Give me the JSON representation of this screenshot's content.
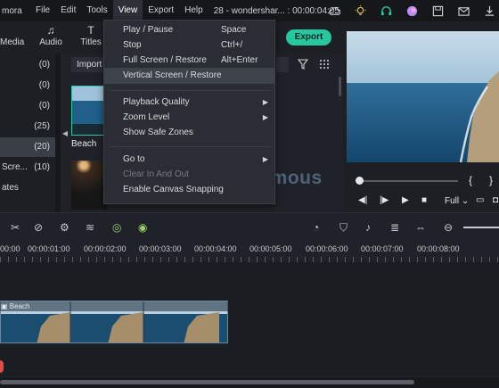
{
  "menubar": {
    "app_name": "mora",
    "items": [
      "File",
      "Edit",
      "Tools",
      "View",
      "Export",
      "Help"
    ],
    "window_title": "28 - wondershar... : 00:00:04:05"
  },
  "toolbar": {
    "media_label": "Media",
    "audio_label": "Audio",
    "titles_label": "Titles",
    "export_label": "Export"
  },
  "library": {
    "rows": [
      {
        "label": "",
        "count": "(0)"
      },
      {
        "label": "",
        "count": "(0)"
      },
      {
        "label": "",
        "count": "(0)"
      },
      {
        "label": "",
        "count": "(25)"
      },
      {
        "label": "",
        "count": "(20)"
      },
      {
        "label": "Scre...",
        "count": "(10)"
      },
      {
        "label": "ates",
        "count": ""
      }
    ]
  },
  "media": {
    "import_label": "Import",
    "items": [
      {
        "label": "Beach"
      }
    ]
  },
  "view_menu": {
    "items": [
      {
        "label": "Play / Pause",
        "shortcut": "Space"
      },
      {
        "label": "Stop",
        "shortcut": "Ctrl+/"
      },
      {
        "label": "Full Screen / Restore",
        "shortcut": "Alt+Enter"
      },
      {
        "label": "Vertical Screen / Restore",
        "shortcut": ""
      },
      {
        "label": "Playback Quality",
        "shortcut": ""
      },
      {
        "label": "Zoom Level",
        "shortcut": ""
      },
      {
        "label": "Show Safe Zones",
        "shortcut": ""
      },
      {
        "label": "Go to",
        "shortcut": ""
      },
      {
        "label": "Clear In And Out",
        "shortcut": ""
      },
      {
        "label": "Enable Canvas Snapping",
        "shortcut": ""
      }
    ]
  },
  "preview": {
    "quality_label": "Full",
    "brace_left": "{",
    "brace_right": "}"
  },
  "ruler": {
    "ticks": [
      "00:00",
      "00:00:01:00",
      "00:00:02:00",
      "00:00:03:00",
      "00:00:04:00",
      "00:00:05:00",
      "00:00:06:00",
      "00:00:07:00",
      "00:00:08:00"
    ]
  },
  "clip": {
    "label": "Beach"
  },
  "watermark": {
    "text": "FileFamous"
  },
  "colors": {
    "accent": "#27c7a0",
    "panel": "#1f2228",
    "menu": "#2a2d33"
  }
}
